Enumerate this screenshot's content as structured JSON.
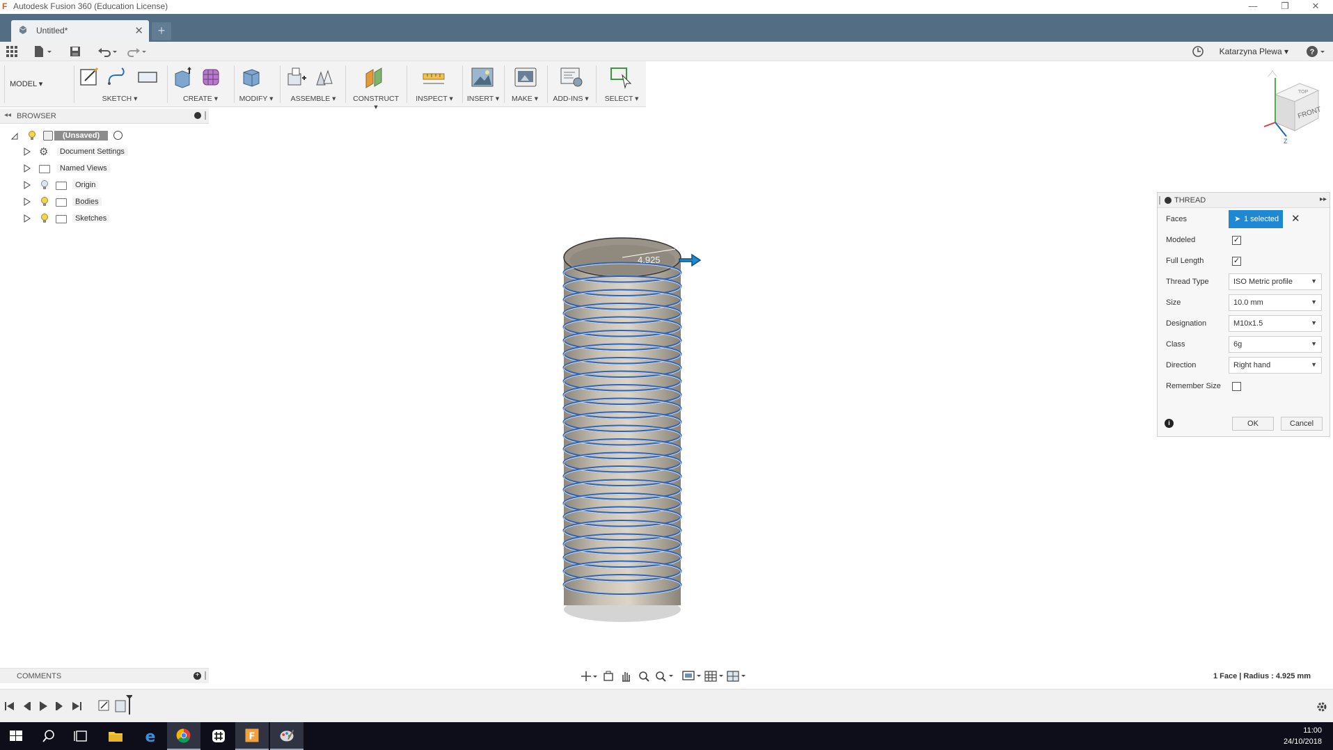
{
  "window": {
    "title": "Autodesk Fusion 360 (Education License)"
  },
  "tab": {
    "label": "Untitled*"
  },
  "quickaccess": {
    "user": "Katarzyna Plewa"
  },
  "toolbar": {
    "workspace": "MODEL",
    "groups": [
      "SKETCH",
      "CREATE",
      "MODIFY",
      "ASSEMBLE",
      "CONSTRUCT",
      "INSPECT",
      "INSERT",
      "MAKE",
      "ADD-INS",
      "SELECT"
    ]
  },
  "browser": {
    "title": "BROWSER",
    "root": "(Unsaved)",
    "items": [
      "Document Settings",
      "Named Views",
      "Origin",
      "Bodies",
      "Sketches"
    ]
  },
  "viewcube": {
    "top": "TOP",
    "front": "FRONT",
    "axis_z": "Z"
  },
  "viewport": {
    "dimension": "4.925"
  },
  "thread": {
    "title": "THREAD",
    "faces_label": "Faces",
    "faces_value": "1 selected",
    "modeled_label": "Modeled",
    "full_length_label": "Full Length",
    "thread_type_label": "Thread Type",
    "thread_type": "ISO Metric profile",
    "size_label": "Size",
    "size": "10.0 mm",
    "designation_label": "Designation",
    "designation": "M10x1.5",
    "class_label": "Class",
    "class": "6g",
    "direction_label": "Direction",
    "direction": "Right hand",
    "remember_label": "Remember Size",
    "ok": "OK",
    "cancel": "Cancel"
  },
  "comments": {
    "title": "COMMENTS"
  },
  "status": {
    "text": "1 Face | Radius : 4.925 mm"
  },
  "clock": {
    "time": "11:00",
    "date": "24/10/2018"
  },
  "colors": {
    "accent": "#1e88d3",
    "tabstrip": "#536d85",
    "taskbar": "#0e0e1a"
  }
}
